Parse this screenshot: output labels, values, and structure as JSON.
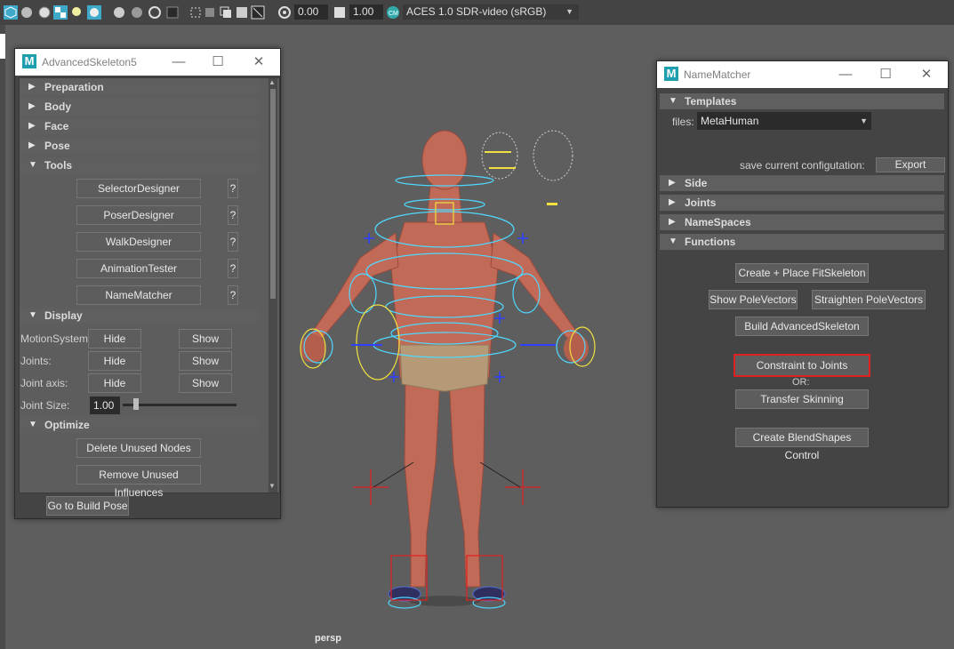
{
  "toolbar": {
    "exposure_value": "0.00",
    "gamma_value": "1.00",
    "color_space": "ACES 1.0 SDR-video (sRGB)"
  },
  "viewport": {
    "camera_label": "persp"
  },
  "advanced_skeleton": {
    "title": "AdvancedSkeleton5",
    "sections": {
      "preparation": "Preparation",
      "body": "Body",
      "face": "Face",
      "pose": "Pose",
      "tools": "Tools",
      "display": "Display",
      "optimize": "Optimize"
    },
    "tools": [
      {
        "label": "SelectorDesigner",
        "help": "?"
      },
      {
        "label": "PoserDesigner",
        "help": "?"
      },
      {
        "label": "WalkDesigner",
        "help": "?"
      },
      {
        "label": "AnimationTester",
        "help": "?"
      },
      {
        "label": "NameMatcher",
        "help": "?"
      }
    ],
    "display_rows": [
      {
        "label": "MotionSystem:",
        "hide": "Hide",
        "show": "Show"
      },
      {
        "label": "Joints:",
        "hide": "Hide",
        "show": "Show"
      },
      {
        "label": "Joint axis:",
        "hide": "Hide",
        "show": "Show"
      }
    ],
    "joint_size_label": "Joint Size:",
    "joint_size_value": "1.00",
    "optimize_buttons": [
      "Delete Unused Nodes",
      "Remove Unused Influences"
    ],
    "go_to_build_pose": "Go to Build Pose"
  },
  "name_matcher": {
    "title": "NameMatcher",
    "sections": {
      "templates": "Templates",
      "side": "Side",
      "joints": "Joints",
      "namespaces": "NameSpaces",
      "functions": "Functions"
    },
    "files_label": "files:",
    "files_value": "MetaHuman",
    "save_config_label": "save current configutation:",
    "export_button": "Export",
    "functions": {
      "create_place_fitskeleton": "Create + Place FitSkeleton",
      "show_polevectors": "Show PoleVectors",
      "straighten_polevectors": "Straighten PoleVectors",
      "build_advancedskeleton": "Build AdvancedSkeleton",
      "constraint_to_joints": "Constraint to Joints",
      "or_label": "OR:",
      "transfer_skinning": "Transfer Skinning",
      "create_blendshapes_control": "Create BlendShapes Control"
    }
  },
  "colors": {
    "highlight_border": "#e02020",
    "maya_logo": "#1e9fb0",
    "controller_cyan": "#4fd8ff",
    "controller_yellow": "#f0e040"
  }
}
